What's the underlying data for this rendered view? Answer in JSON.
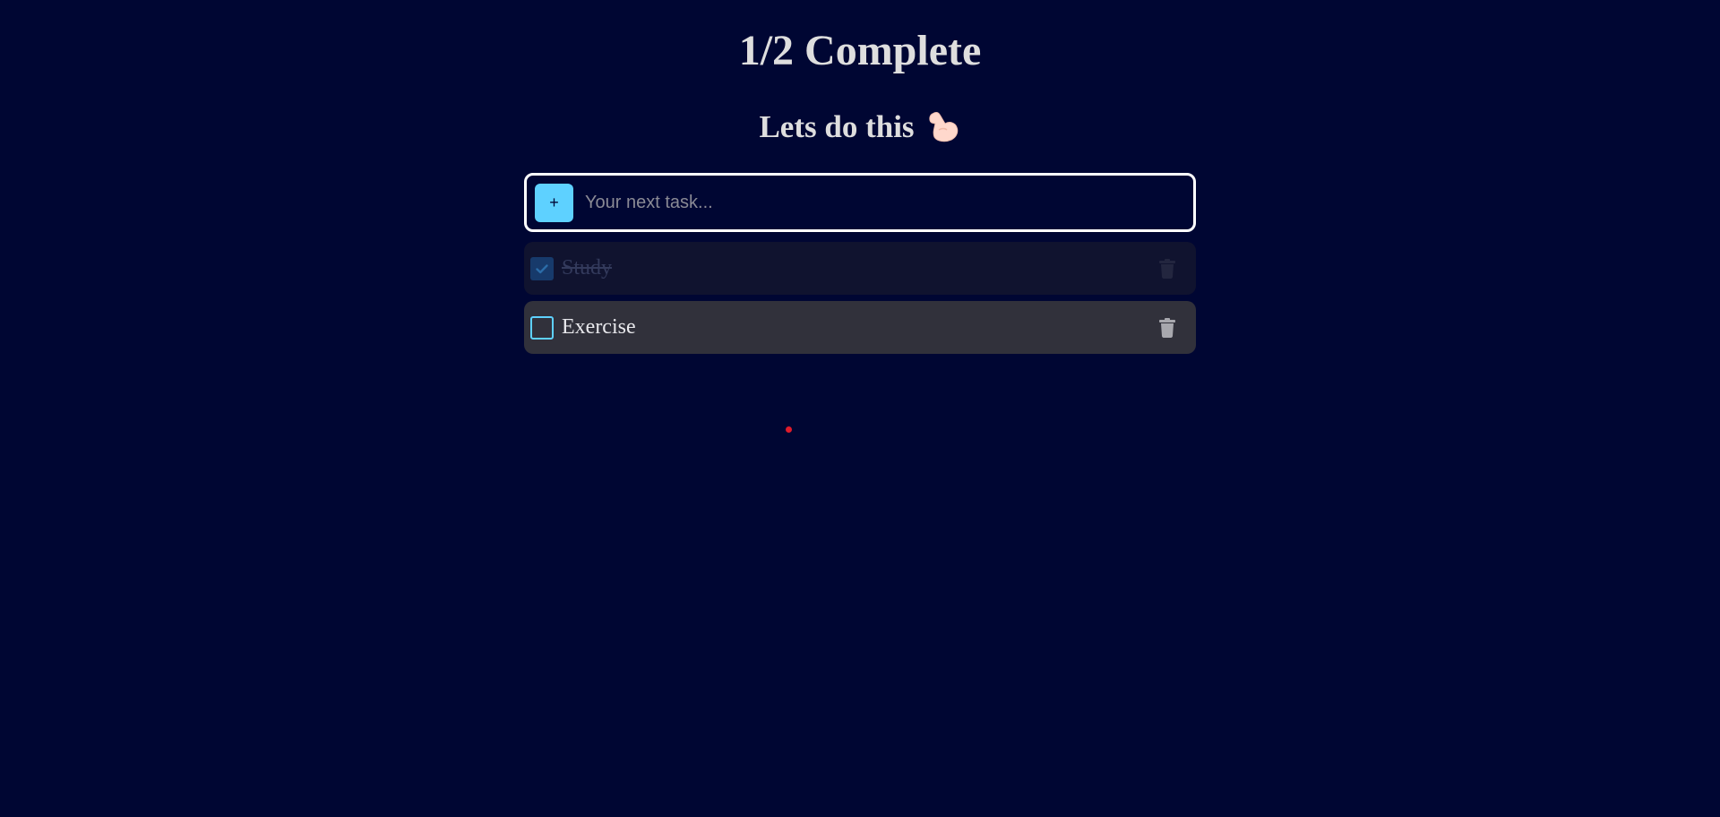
{
  "header": {
    "title": "1/2 Complete",
    "subtitle": "Lets do this"
  },
  "input": {
    "add_label": "+",
    "placeholder": "Your next task...",
    "value": ""
  },
  "tasks": [
    {
      "label": "Study",
      "completed": true
    },
    {
      "label": "Exercise",
      "completed": false
    }
  ],
  "colors": {
    "background": "#000633",
    "accent": "#5ed1ff",
    "done_row": "#10132f",
    "todo_row": "#31313b",
    "cursor_dot": "#e01b2a"
  },
  "icons": {
    "subtitle_emoji": "flexed-biceps-icon",
    "check": "checkmark-icon",
    "delete": "trash-icon"
  }
}
